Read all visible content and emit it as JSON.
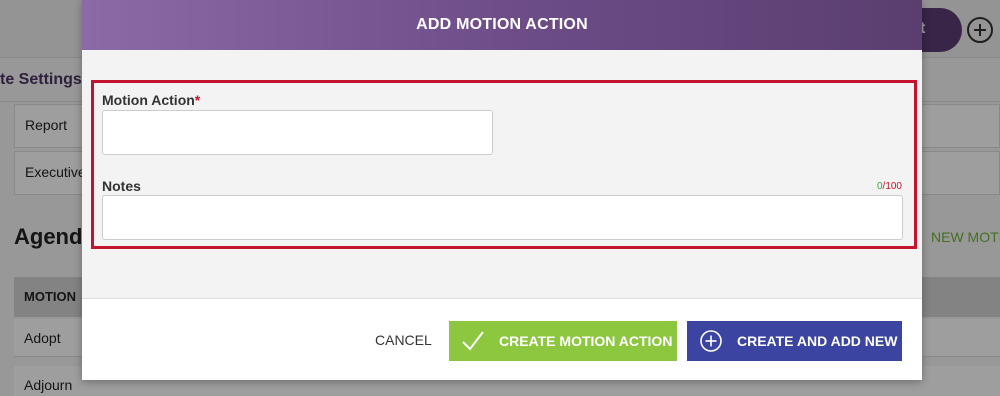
{
  "background": {
    "report_button": "ort",
    "settings_tab": "te Settings",
    "rows": [
      "Report",
      "Executive"
    ],
    "agenda_title": "Agenda",
    "new_motion_button": "NEW MOTI",
    "table_header": "MOTION",
    "table_rows": [
      "Adopt",
      "Adjourn"
    ]
  },
  "modal": {
    "title": "ADD MOTION ACTION",
    "motion_action": {
      "label": "Motion Action",
      "required_mark": "*",
      "value": "",
      "placeholder": ""
    },
    "notes": {
      "label": "Notes",
      "value": "",
      "placeholder": "",
      "counter_current": "0",
      "counter_separator": "/",
      "counter_max": "100"
    },
    "footer": {
      "cancel_label": "CANCEL",
      "create_label": "CREATE MOTION ACTION",
      "create_and_add_label": "CREATE AND ADD NEW"
    }
  },
  "colors": {
    "header_purple": "#6e4d88",
    "highlight_red": "#c4122f",
    "create_green": "#8dc63f",
    "create_new_blue": "#3b44a0"
  },
  "icons": {
    "create_button_icon": "check-icon",
    "create_new_button_icon": "plus-circle-icon",
    "topbar_add_icon": "plus-circle-icon"
  }
}
